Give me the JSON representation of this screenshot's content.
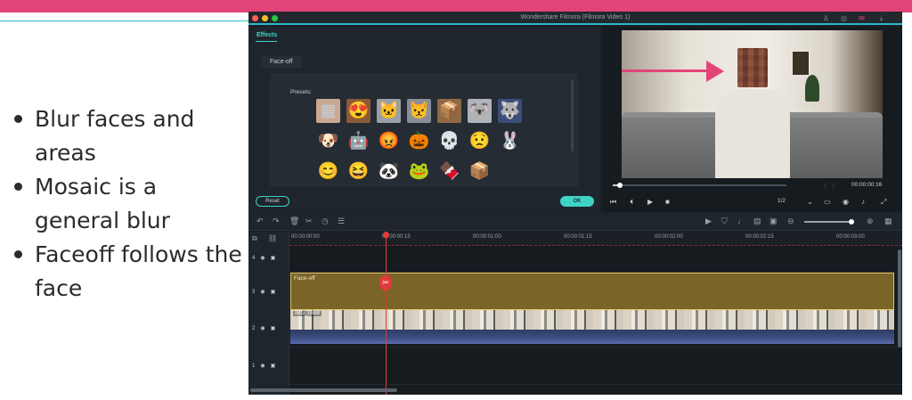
{
  "slide": {
    "bullets": [
      "Blur faces and areas",
      "Mosaic is a general blur",
      "Faceoff follows the face"
    ],
    "accent_color": "#e2447a"
  },
  "app": {
    "window_title": "Wondershare Filmora (Filmora Video 1)",
    "effects_tab": "Effects",
    "subtab": "Face-off",
    "presets_label": "Presets:",
    "presets": [
      {
        "glyph": "▦",
        "bg": "#c9a892"
      },
      {
        "glyph": "😍",
        "bg": "#8a5a3a"
      },
      {
        "glyph": "🐱",
        "bg": "#9aa0a6"
      },
      {
        "glyph": "😾",
        "bg": "#8a8f97"
      },
      {
        "glyph": "📦",
        "bg": "#8d6a45"
      },
      {
        "glyph": "🐨",
        "bg": "#b0b3b8"
      },
      {
        "glyph": "🐺",
        "bg": "#3b4d7a"
      },
      {
        "glyph": "🐶",
        "bg": "transparent"
      },
      {
        "glyph": "🤖",
        "bg": "transparent"
      },
      {
        "glyph": "😡",
        "bg": "transparent"
      },
      {
        "glyph": "🎃",
        "bg": "transparent"
      },
      {
        "glyph": "💀",
        "bg": "transparent"
      },
      {
        "glyph": "😟",
        "bg": "transparent"
      },
      {
        "glyph": "🐰",
        "bg": "transparent"
      },
      {
        "glyph": "😊",
        "bg": "transparent"
      },
      {
        "glyph": "😆",
        "bg": "transparent"
      },
      {
        "glyph": "🐼",
        "bg": "transparent"
      },
      {
        "glyph": "🐸",
        "bg": "transparent"
      },
      {
        "glyph": "🍫",
        "bg": "transparent"
      },
      {
        "glyph": "📦",
        "bg": "transparent"
      }
    ],
    "reset_label": "Reset",
    "ok_label": "OK",
    "preview_time": "00:00:00:16",
    "preview_progress": 0.04,
    "preview_ratio": "1/2",
    "ruler_ticks": [
      "00:00:00:00",
      "00:00:00:15",
      "00:00:01:00",
      "00:00:01:15",
      "00:00:02:00",
      "00:00:02:15",
      "00:00:03:00"
    ],
    "tracks": [
      "4",
      "3",
      "2",
      "1"
    ],
    "faceoff_clip_label": "Face-off",
    "video_clip_label": "IMG_0888",
    "zoom_level": 0.95
  }
}
